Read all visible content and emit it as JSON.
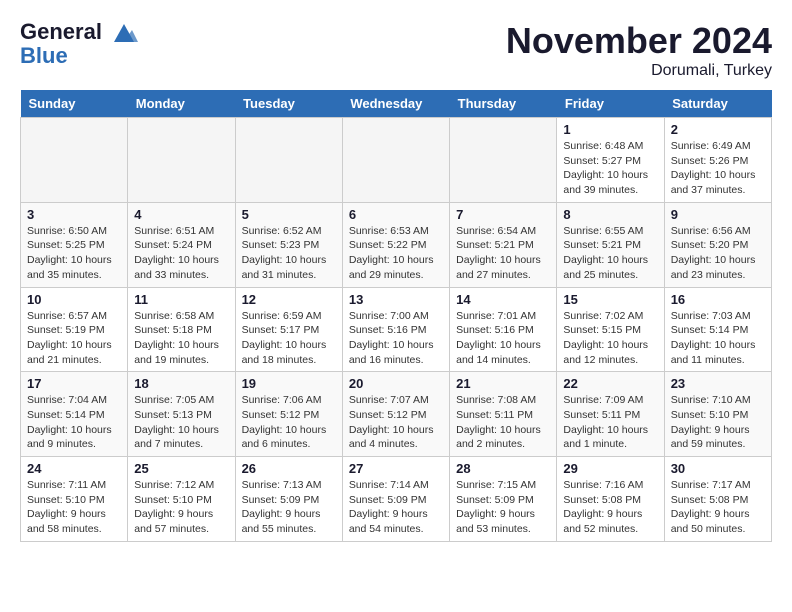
{
  "header": {
    "logo_line1": "General",
    "logo_line2": "Blue",
    "month_title": "November 2024",
    "location": "Dorumali, Turkey"
  },
  "weekdays": [
    "Sunday",
    "Monday",
    "Tuesday",
    "Wednesday",
    "Thursday",
    "Friday",
    "Saturday"
  ],
  "weeks": [
    [
      {
        "day": "",
        "info": ""
      },
      {
        "day": "",
        "info": ""
      },
      {
        "day": "",
        "info": ""
      },
      {
        "day": "",
        "info": ""
      },
      {
        "day": "",
        "info": ""
      },
      {
        "day": "1",
        "info": "Sunrise: 6:48 AM\nSunset: 5:27 PM\nDaylight: 10 hours and 39 minutes."
      },
      {
        "day": "2",
        "info": "Sunrise: 6:49 AM\nSunset: 5:26 PM\nDaylight: 10 hours and 37 minutes."
      }
    ],
    [
      {
        "day": "3",
        "info": "Sunrise: 6:50 AM\nSunset: 5:25 PM\nDaylight: 10 hours and 35 minutes."
      },
      {
        "day": "4",
        "info": "Sunrise: 6:51 AM\nSunset: 5:24 PM\nDaylight: 10 hours and 33 minutes."
      },
      {
        "day": "5",
        "info": "Sunrise: 6:52 AM\nSunset: 5:23 PM\nDaylight: 10 hours and 31 minutes."
      },
      {
        "day": "6",
        "info": "Sunrise: 6:53 AM\nSunset: 5:22 PM\nDaylight: 10 hours and 29 minutes."
      },
      {
        "day": "7",
        "info": "Sunrise: 6:54 AM\nSunset: 5:21 PM\nDaylight: 10 hours and 27 minutes."
      },
      {
        "day": "8",
        "info": "Sunrise: 6:55 AM\nSunset: 5:21 PM\nDaylight: 10 hours and 25 minutes."
      },
      {
        "day": "9",
        "info": "Sunrise: 6:56 AM\nSunset: 5:20 PM\nDaylight: 10 hours and 23 minutes."
      }
    ],
    [
      {
        "day": "10",
        "info": "Sunrise: 6:57 AM\nSunset: 5:19 PM\nDaylight: 10 hours and 21 minutes."
      },
      {
        "day": "11",
        "info": "Sunrise: 6:58 AM\nSunset: 5:18 PM\nDaylight: 10 hours and 19 minutes."
      },
      {
        "day": "12",
        "info": "Sunrise: 6:59 AM\nSunset: 5:17 PM\nDaylight: 10 hours and 18 minutes."
      },
      {
        "day": "13",
        "info": "Sunrise: 7:00 AM\nSunset: 5:16 PM\nDaylight: 10 hours and 16 minutes."
      },
      {
        "day": "14",
        "info": "Sunrise: 7:01 AM\nSunset: 5:16 PM\nDaylight: 10 hours and 14 minutes."
      },
      {
        "day": "15",
        "info": "Sunrise: 7:02 AM\nSunset: 5:15 PM\nDaylight: 10 hours and 12 minutes."
      },
      {
        "day": "16",
        "info": "Sunrise: 7:03 AM\nSunset: 5:14 PM\nDaylight: 10 hours and 11 minutes."
      }
    ],
    [
      {
        "day": "17",
        "info": "Sunrise: 7:04 AM\nSunset: 5:14 PM\nDaylight: 10 hours and 9 minutes."
      },
      {
        "day": "18",
        "info": "Sunrise: 7:05 AM\nSunset: 5:13 PM\nDaylight: 10 hours and 7 minutes."
      },
      {
        "day": "19",
        "info": "Sunrise: 7:06 AM\nSunset: 5:12 PM\nDaylight: 10 hours and 6 minutes."
      },
      {
        "day": "20",
        "info": "Sunrise: 7:07 AM\nSunset: 5:12 PM\nDaylight: 10 hours and 4 minutes."
      },
      {
        "day": "21",
        "info": "Sunrise: 7:08 AM\nSunset: 5:11 PM\nDaylight: 10 hours and 2 minutes."
      },
      {
        "day": "22",
        "info": "Sunrise: 7:09 AM\nSunset: 5:11 PM\nDaylight: 10 hours and 1 minute."
      },
      {
        "day": "23",
        "info": "Sunrise: 7:10 AM\nSunset: 5:10 PM\nDaylight: 9 hours and 59 minutes."
      }
    ],
    [
      {
        "day": "24",
        "info": "Sunrise: 7:11 AM\nSunset: 5:10 PM\nDaylight: 9 hours and 58 minutes."
      },
      {
        "day": "25",
        "info": "Sunrise: 7:12 AM\nSunset: 5:10 PM\nDaylight: 9 hours and 57 minutes."
      },
      {
        "day": "26",
        "info": "Sunrise: 7:13 AM\nSunset: 5:09 PM\nDaylight: 9 hours and 55 minutes."
      },
      {
        "day": "27",
        "info": "Sunrise: 7:14 AM\nSunset: 5:09 PM\nDaylight: 9 hours and 54 minutes."
      },
      {
        "day": "28",
        "info": "Sunrise: 7:15 AM\nSunset: 5:09 PM\nDaylight: 9 hours and 53 minutes."
      },
      {
        "day": "29",
        "info": "Sunrise: 7:16 AM\nSunset: 5:08 PM\nDaylight: 9 hours and 52 minutes."
      },
      {
        "day": "30",
        "info": "Sunrise: 7:17 AM\nSunset: 5:08 PM\nDaylight: 9 hours and 50 minutes."
      }
    ]
  ]
}
